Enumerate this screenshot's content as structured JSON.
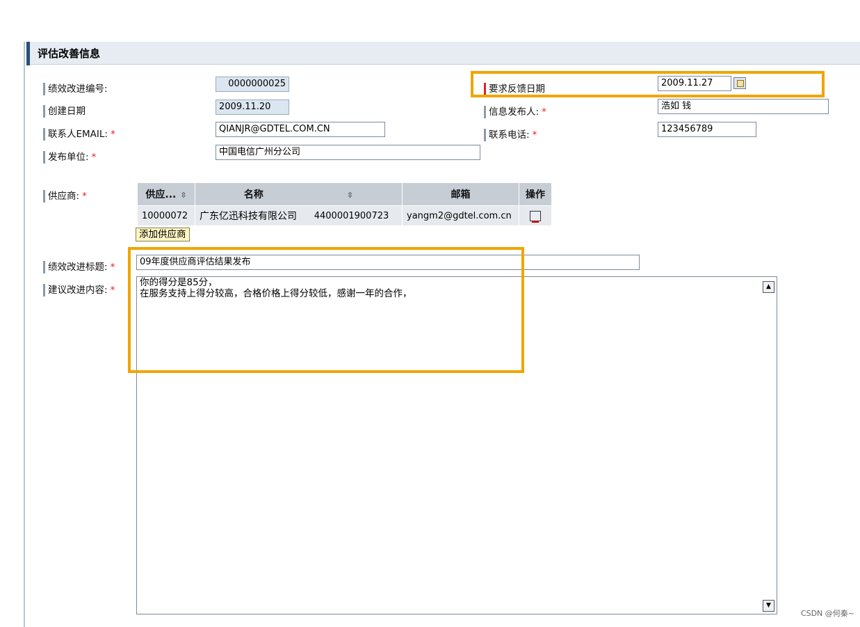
{
  "header": {
    "title": "评估改善信息"
  },
  "fields": {
    "improve_no": {
      "label": "绩效改进编号:",
      "value": "0000000025"
    },
    "create_date": {
      "label": "创建日期",
      "value": "2009.11.20"
    },
    "contact_email": {
      "label": "联系人EMAIL:",
      "value": "QIANJR@GDTEL.COM.CN"
    },
    "publish_unit": {
      "label": "发布单位:",
      "value": "中国电信广州分公司"
    },
    "feedback_date": {
      "label": "要求反馈日期",
      "value": "2009.11.27"
    },
    "publisher": {
      "label": "信息发布人:",
      "value": "浩如 钱"
    },
    "phone": {
      "label": "联系电话:",
      "value": "123456789"
    },
    "supplier": {
      "label": "供应商:"
    },
    "improve_title": {
      "label": "绩效改进标题:",
      "value": "09年度供应商评估结果发布"
    },
    "suggest_content": {
      "label": "建议改进内容:",
      "line1": "你的得分是85分，",
      "line2": "在服务支持上得分较高，合格价格上得分较低，感谢一年的合作，"
    }
  },
  "required_mark": "*",
  "supplier_table": {
    "headers": {
      "id": "供应...",
      "name": "名称",
      "email": "邮箱",
      "action": "操作"
    },
    "sort_glyph": "⇳",
    "rows": [
      {
        "id": "10000072",
        "name": "广东亿迅科技有限公司",
        "code": "4400001900723",
        "email": "yangm2@gdtel.com.cn"
      }
    ]
  },
  "add_supplier_button": "添加供应商",
  "scroll": {
    "up": "▲",
    "down": "▼"
  },
  "watermark": "CSDN @何秦~",
  "colors": {
    "highlight": "#f0a500",
    "header_accent": "#2b4f7b",
    "required": "#e02020"
  }
}
